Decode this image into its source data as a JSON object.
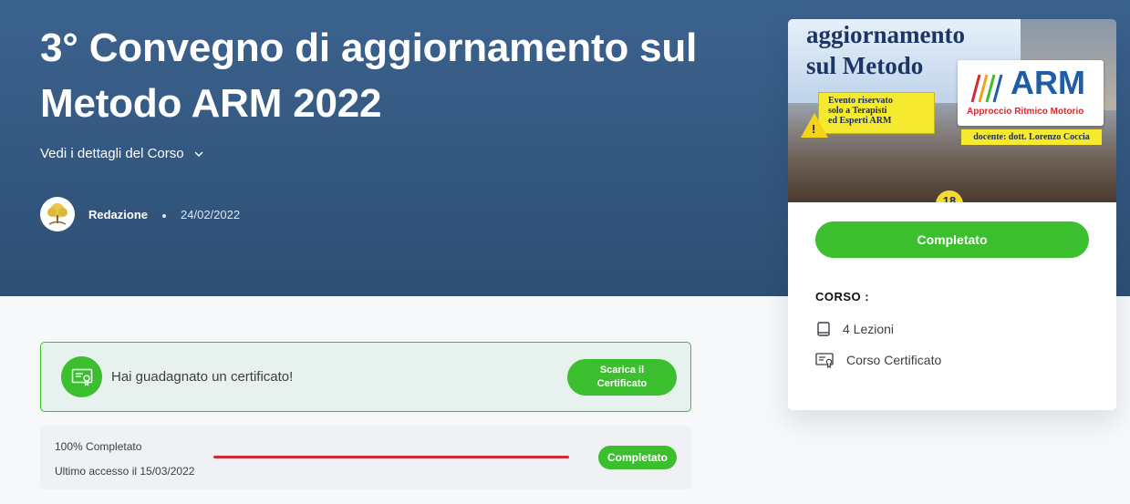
{
  "hero": {
    "title": "3° Convegno di aggiornamento sul Metodo ARM 2022",
    "details_toggle": "Vedi i dettagli del Corso",
    "author": "Redazione",
    "date": "24/02/2022"
  },
  "certificate": {
    "message": "Hai guadagnato un certificato!",
    "download_label": "Scarica il Certificato"
  },
  "progress": {
    "percent_text": "100% Completato",
    "percent_value": 100,
    "last_access": "Ultimo accesso il 15/03/2022",
    "status": "Completato",
    "bar_color": "#cf2b33"
  },
  "course_card": {
    "thumbnail": {
      "title_line1": "aggiornamento",
      "title_line2": "sul Metodo",
      "note_line1": "Evento riservato",
      "note_line2": "solo a Terapisti",
      "note_line3": "ed Esperti ARM",
      "logo_text": "ARM",
      "logo_subtitle": "Approccio Ritmico Motorio",
      "docente": "docente: dott. Lorenzo Coccia",
      "badge": "18"
    },
    "status_button": "Completato",
    "section_label": "CORSO :",
    "features": [
      {
        "icon": "book-icon",
        "label": "4 Lezioni"
      },
      {
        "icon": "certificate-icon",
        "label": "Corso Certificato"
      }
    ]
  },
  "colors": {
    "accent_green": "#3cbf2f",
    "hero_blue": "#345a84",
    "progress_red": "#cf2b33"
  }
}
